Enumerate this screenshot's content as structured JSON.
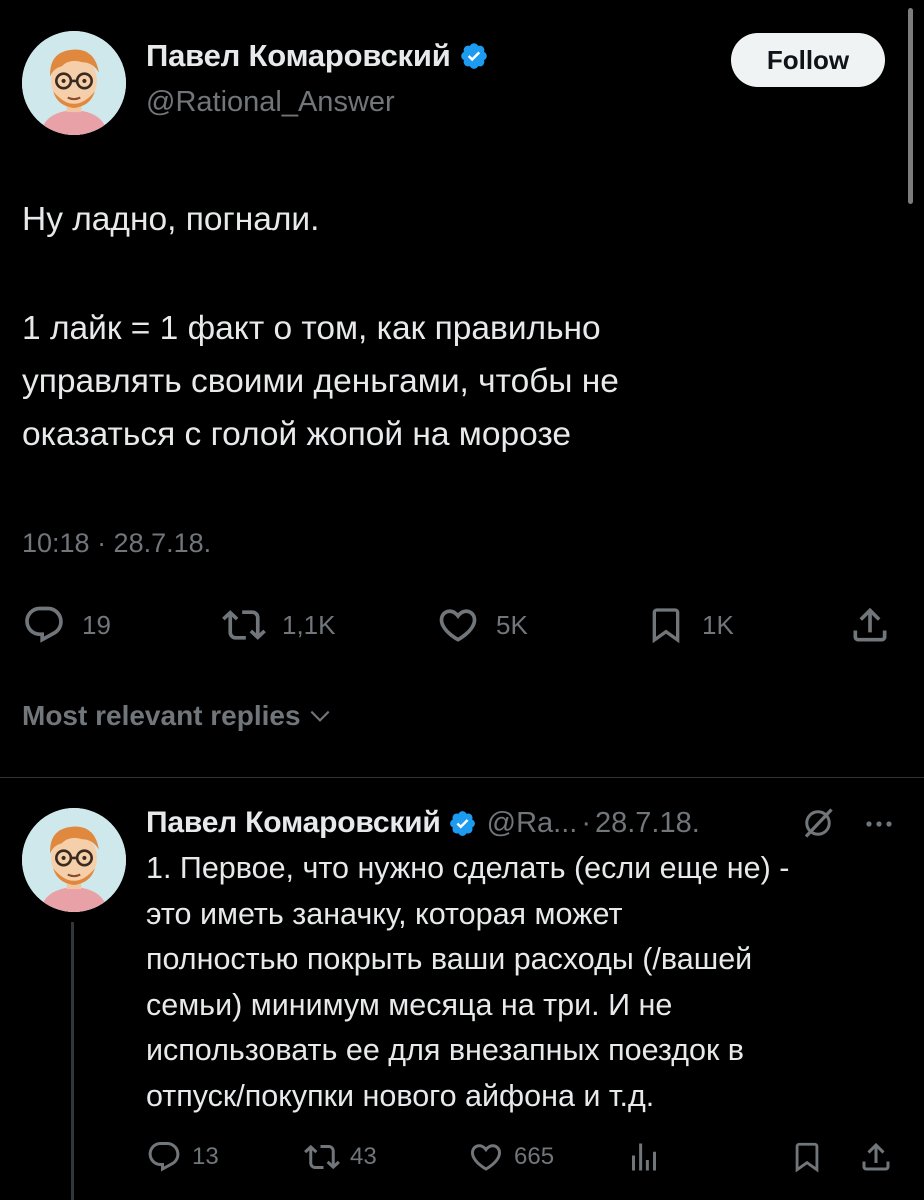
{
  "colors": {
    "background": "#000000",
    "text_primary": "#e7e9ea",
    "text_secondary": "#71767b",
    "verified_blue": "#1d9bf0",
    "follow_button_bg": "#eff3f4",
    "divider": "#2f3336"
  },
  "main_tweet": {
    "author": {
      "display_name": "Павел Комаровский",
      "handle": "@Rational_Answer",
      "avatar_icon": "cartoon-avatar",
      "verified_icon": "verified-badge-icon"
    },
    "follow_label": "Follow",
    "text_lines": [
      "Ну ладно, погнали.",
      "1 лайк = 1 факт о том, как правильно",
      "управлять своими деньгами, чтобы не",
      "оказаться с голой жопой на морозе"
    ],
    "timestamp": "10:18 · 28.7.18.",
    "actions": {
      "replies": "19",
      "reposts": "1,1K",
      "likes": "5K",
      "bookmarks": "1K"
    }
  },
  "replies_sort": {
    "label": "Most relevant replies",
    "icon": "chevron-down-icon"
  },
  "reply": {
    "author": {
      "display_name": "Павел Комаровский",
      "handle": "@Ra...",
      "separator": "·",
      "date": "28.7.18.",
      "avatar_icon": "cartoon-avatar",
      "verified_icon": "verified-badge-icon"
    },
    "text_lines": [
      "1. Первое, что нужно сделать (если еще не) -",
      "это иметь заначку, которая может",
      "полностью покрыть ваши расходы (/вашей",
      "семьи) минимум месяца на три. И не",
      "использовать ее для внезапных поездок в",
      "отпуск/покупки нового айфона и т.д."
    ],
    "actions": {
      "replies": "13",
      "reposts": "43",
      "likes": "665"
    }
  }
}
